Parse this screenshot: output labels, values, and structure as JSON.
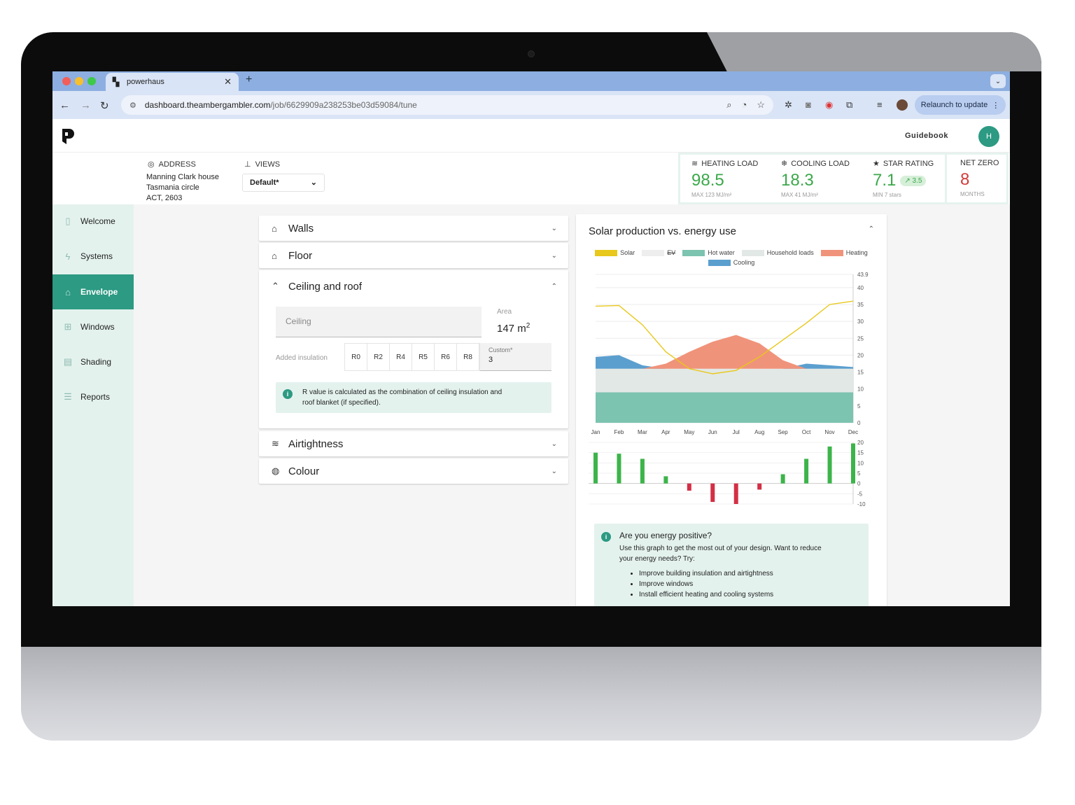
{
  "browser": {
    "tab_title": "powerhaus",
    "url_host": "dashboard.theambergambler.com",
    "url_path": "/job/6629909a238253be03d59084/tune",
    "relaunch_label": "Relaunch to update"
  },
  "header": {
    "guidebook": "Guidebook",
    "avatar_initial": "H"
  },
  "address": {
    "label": "ADDRESS",
    "line1": "Manning Clark house",
    "line2": "Tasmania circle",
    "line3": "ACT, 2603"
  },
  "views": {
    "label": "VIEWS",
    "selected": "Default*"
  },
  "metrics": {
    "heating": {
      "label": "HEATING LOAD",
      "value": "98.5",
      "sub": "MAX 123 MJ/m²"
    },
    "cooling": {
      "label": "COOLING LOAD",
      "value": "18.3",
      "sub": "MAX 41 MJ/m²"
    },
    "star": {
      "label": "STAR RATING",
      "value": "7.1",
      "badge": "3.5",
      "sub": "MIN 7 stars"
    },
    "netzero": {
      "label": "NET ZERO",
      "value": "8",
      "sub": "MONTHS"
    }
  },
  "sidebar": {
    "items": [
      {
        "label": "Welcome",
        "icon": "door-icon"
      },
      {
        "label": "Systems",
        "icon": "bolt-icon"
      },
      {
        "label": "Envelope",
        "icon": "house-icon"
      },
      {
        "label": "Windows",
        "icon": "window-icon"
      },
      {
        "label": "Shading",
        "icon": "shade-icon"
      },
      {
        "label": "Reports",
        "icon": "report-icon"
      }
    ]
  },
  "panels": {
    "walls": "Walls",
    "floor": "Floor",
    "ceiling_roof": "Ceiling and roof",
    "airtightness": "Airtightness",
    "colour": "Colour"
  },
  "ceiling": {
    "field_placeholder": "Ceiling",
    "area_label": "Area",
    "area_value": "147 m",
    "area_unit_sup": "2",
    "insulation_label": "Added insulation",
    "r_options": [
      "R0",
      "R2",
      "R4",
      "R5",
      "R6",
      "R8"
    ],
    "custom_label": "Custom*",
    "custom_value": "3",
    "info_line1": "R value is calculated as the combination of ceiling insulation and",
    "info_line2": "roof blanket (if specified)."
  },
  "chart_card": {
    "title": "Solar production vs. energy use"
  },
  "energy_box": {
    "question": "Are you energy positive?",
    "line1": "Use this graph to get the most out of your design. Want to reduce",
    "line2": "your energy needs? Try:",
    "tips": [
      "Improve building insulation and airtightness",
      "Improve windows",
      "Install efficient heating and cooling systems"
    ]
  },
  "chart_data": [
    {
      "type": "area",
      "categories": [
        "Jan",
        "Feb",
        "Mar",
        "Apr",
        "May",
        "Jun",
        "Jul",
        "Aug",
        "Sep",
        "Oct",
        "Nov",
        "Dec"
      ],
      "ylim": [
        0,
        43.9
      ],
      "yticks": [
        0,
        5,
        10,
        15,
        20,
        25,
        30,
        35,
        40,
        43.9
      ],
      "legend": [
        {
          "name": "Solar",
          "color": "#e8c81a"
        },
        {
          "name": "EV",
          "color": "#eeeeee",
          "disabled": true
        },
        {
          "name": "Hot water",
          "color": "#7cc3b0"
        },
        {
          "name": "Household loads",
          "color": "#e2e8e6"
        },
        {
          "name": "Heating",
          "color": "#f0937b"
        },
        {
          "name": "Cooling",
          "color": "#5b9fcf"
        }
      ],
      "series": [
        {
          "name": "Hot water",
          "values": [
            9,
            9,
            9,
            9,
            9,
            9,
            9,
            9,
            9,
            9,
            9,
            9
          ]
        },
        {
          "name": "Household loads",
          "values": [
            7,
            7,
            7,
            7,
            7,
            7,
            7,
            7,
            7,
            7,
            7,
            7
          ]
        },
        {
          "name": "Cooling",
          "values": [
            3.5,
            4,
            1,
            0,
            0,
            0,
            0,
            0,
            0,
            1.5,
            1,
            0.5
          ]
        },
        {
          "name": "Heating",
          "values": [
            0,
            0,
            0,
            1.5,
            5,
            8,
            10,
            7.5,
            2.5,
            0,
            0,
            0
          ]
        },
        {
          "name": "Solar",
          "values": [
            34.5,
            34.7,
            29,
            21,
            16,
            14.5,
            15.5,
            19.5,
            24.5,
            29.5,
            35,
            36
          ]
        }
      ]
    },
    {
      "type": "bar",
      "categories": [
        "Jan",
        "Feb",
        "Mar",
        "Apr",
        "May",
        "Jun",
        "Jul",
        "Aug",
        "Sep",
        "Oct",
        "Nov",
        "Dec"
      ],
      "ylim": [
        -10,
        20
      ],
      "yticks": [
        20,
        15,
        10,
        5,
        0,
        -5,
        -10
      ],
      "values": [
        15,
        14.5,
        12,
        3.5,
        -3.5,
        -9,
        -10,
        -3,
        4.5,
        12,
        18,
        19.5
      ],
      "colors": {
        "positive": "#3cb44a",
        "negative": "#d32f45"
      }
    }
  ]
}
